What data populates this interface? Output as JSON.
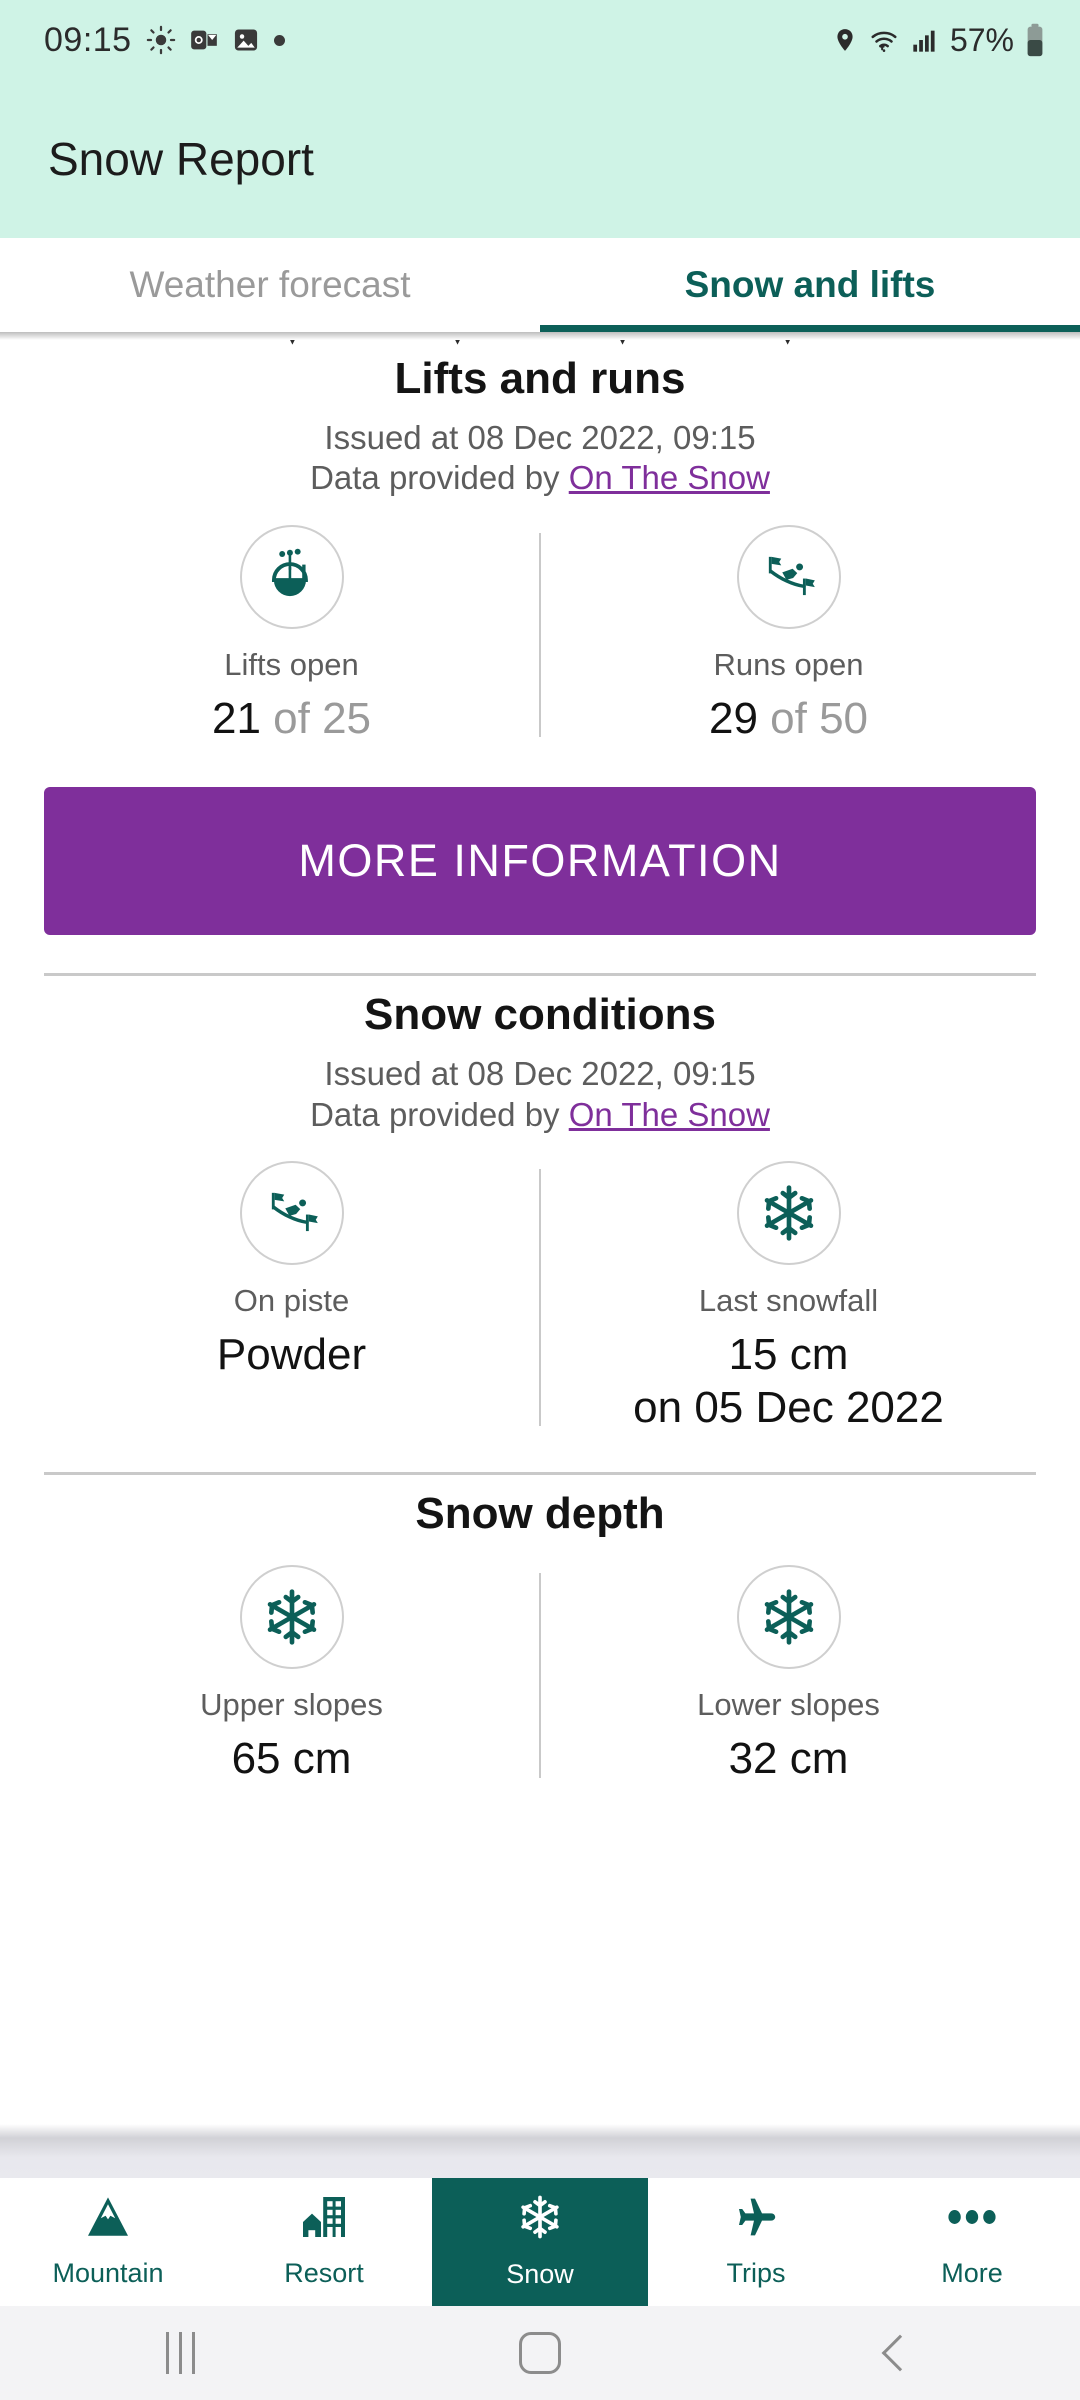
{
  "status_bar": {
    "time": "09:15",
    "battery_percent": "57%",
    "left_icons": [
      "brightness-icon",
      "outlook-icon",
      "photos-icon",
      "notification-dot-icon"
    ],
    "right_icons": [
      "location-icon",
      "wifi-icon",
      "cellular-signal-icon",
      "battery-icon"
    ]
  },
  "app_bar": {
    "title": "Snow Report"
  },
  "tabs": [
    {
      "label": "Weather forecast",
      "active": false
    },
    {
      "label": "Snow and lifts",
      "active": true
    }
  ],
  "sections": {
    "lifts_and_runs": {
      "title": "Lifts and runs",
      "issued": "Issued at 08 Dec 2022, 09:15",
      "provider_prefix": "Data provided by ",
      "provider_link": "On The Snow",
      "items": [
        {
          "icon": "gondola-lift-icon",
          "caption": "Lifts open",
          "value": "21",
          "value_suffix": " of 25"
        },
        {
          "icon": "skier-downhill-icon",
          "caption": "Runs open",
          "value": "29",
          "value_suffix": " of 50"
        }
      ]
    },
    "more_information_button": "MORE INFORMATION",
    "snow_conditions": {
      "title": "Snow conditions",
      "issued": "Issued at 08 Dec 2022, 09:15",
      "provider_prefix": "Data provided by ",
      "provider_link": "On The Snow",
      "items": [
        {
          "icon": "skier-downhill-icon",
          "caption": "On piste",
          "value": "Powder",
          "value_line2": ""
        },
        {
          "icon": "snowflake-icon",
          "caption": "Last snowfall",
          "value": "15 cm",
          "value_line2": "on 05 Dec 2022"
        }
      ]
    },
    "snow_depth": {
      "title": "Snow depth",
      "items": [
        {
          "icon": "snowflake-icon",
          "caption": "Upper slopes",
          "value": "65 cm"
        },
        {
          "icon": "snowflake-icon",
          "caption": "Lower slopes",
          "value": "32 cm"
        }
      ]
    }
  },
  "bottom_nav": [
    {
      "label": "Mountain",
      "icon": "mountain-icon",
      "active": false
    },
    {
      "label": "Resort",
      "icon": "building-icon",
      "active": false
    },
    {
      "label": "Snow",
      "icon": "snowflake-icon",
      "active": true
    },
    {
      "label": "Trips",
      "icon": "airplane-icon",
      "active": false
    },
    {
      "label": "More",
      "icon": "overflow-dots-icon",
      "active": false
    }
  ],
  "android_nav": [
    "recents-button",
    "home-button",
    "back-button"
  ],
  "colors": {
    "header_mint": "#CFF3E6",
    "accent_teal": "#0C5F58",
    "button_purple": "#7F2F9B",
    "link_purple": "#7F2F9B"
  }
}
